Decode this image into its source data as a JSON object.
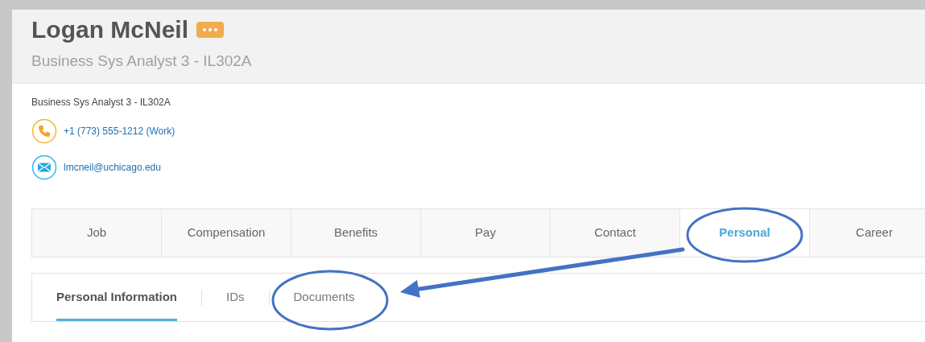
{
  "header": {
    "name": "Logan McNeil",
    "subtitle": "Business Sys Analyst 3 - IL302A"
  },
  "details": {
    "job_title": "Business Sys Analyst 3 - IL302A",
    "phone": "+1 (773) 555-1212 (Work)",
    "email": "lmcneil@uchicago.edu"
  },
  "tabs": [
    {
      "label": "Job",
      "selected": false
    },
    {
      "label": "Compensation",
      "selected": false
    },
    {
      "label": "Benefits",
      "selected": false
    },
    {
      "label": "Pay",
      "selected": false
    },
    {
      "label": "Contact",
      "selected": false
    },
    {
      "label": "Personal",
      "selected": true
    },
    {
      "label": "Career",
      "selected": false
    }
  ],
  "subtabs": [
    {
      "label": "Personal Information",
      "selected": true
    },
    {
      "label": "IDs",
      "selected": false
    },
    {
      "label": "Documents",
      "selected": false
    }
  ]
}
